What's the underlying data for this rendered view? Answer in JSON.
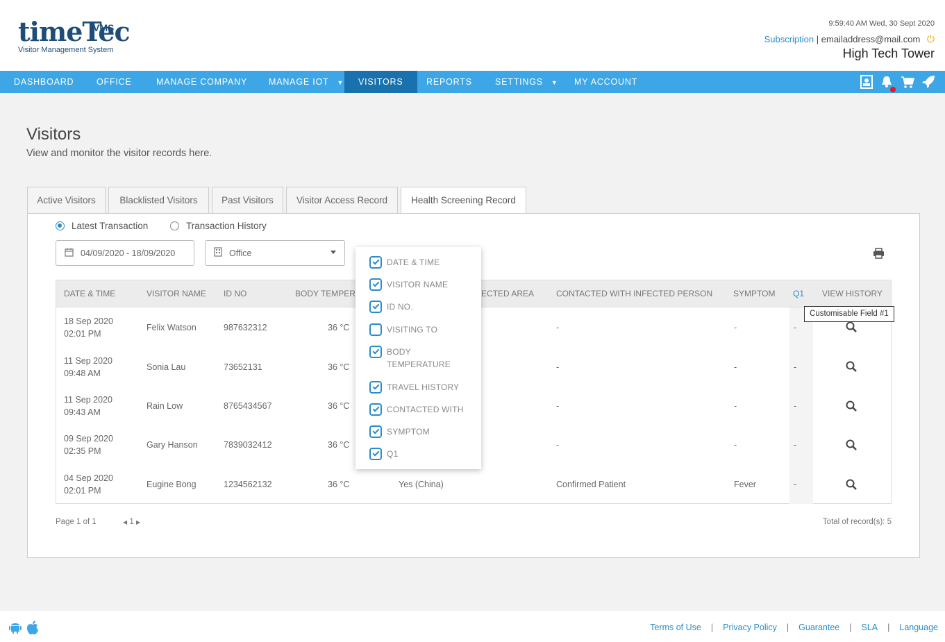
{
  "header": {
    "logo_text": "timeTec",
    "logo_badge": "VMS",
    "logo_subtitle": "Visitor Management System",
    "datetime": "9:59:40 AM  Wed, 30 Sept 2020",
    "subscription_link": "Subscription",
    "separator": "|",
    "email": "emailaddress@mail.com",
    "company": "High Tech Tower"
  },
  "nav": {
    "items": [
      "DASHBOARD",
      "OFFICE",
      "MANAGE COMPANY",
      "MANAGE IOT",
      "VISITORS",
      "REPORTS",
      "SETTINGS",
      "MY ACCOUNT"
    ],
    "active": "VISITORS",
    "icons": [
      "profile-card-icon",
      "notification-bell-icon",
      "cart-icon",
      "rocket-icon"
    ]
  },
  "page": {
    "title": "Visitors",
    "description": "View and monitor the visitor records here."
  },
  "tabs": [
    "Active Visitors",
    "Blacklisted Visitors",
    "Past Visitors",
    "Visitor Access Record",
    "Health Screening Record"
  ],
  "active_tab": "Health Screening Record",
  "view_options": {
    "latest": "Latest Transaction",
    "history": "Transaction History",
    "selected": "Latest Transaction"
  },
  "filters": {
    "date_range": "04/09/2020 - 18/09/2020",
    "location": "Office"
  },
  "table": {
    "headers": [
      "DATE & TIME",
      "VISITOR NAME",
      "ID NO",
      "BODY TEMPERA",
      "ECTED AREA",
      "CONTACTED WITH INFECTED PERSON",
      "SYMPTOM",
      "Q1",
      "VIEW HISTORY"
    ],
    "rows": [
      {
        "date": "18 Sep 2020",
        "time": "02:01 PM",
        "name": "Felix Watson",
        "id": "987632312",
        "temp": "36 °C",
        "area": "",
        "contacted": "-",
        "symptom": "-",
        "q1": "-"
      },
      {
        "date": "11 Sep 2020",
        "time": "09:48 AM",
        "name": "Sonia Lau",
        "id": "73652131",
        "temp": "36 °C",
        "area": "",
        "contacted": "-",
        "symptom": "-",
        "q1": "-"
      },
      {
        "date": "11 Sep 2020",
        "time": "09:43 AM",
        "name": "Rain Low",
        "id": "8765434567",
        "temp": "36 °C",
        "area": "",
        "contacted": "-",
        "symptom": "-",
        "q1": "-"
      },
      {
        "date": "09 Sep 2020",
        "time": "02:35 PM",
        "name": "Gary Hanson",
        "id": "7839032412",
        "temp": "36 °C",
        "area": "",
        "contacted": "-",
        "symptom": "-",
        "q1": "-"
      },
      {
        "date": "04 Sep 2020",
        "time": "02:01 PM",
        "name": "Eugine Bong",
        "id": "1234562132",
        "temp": "36 °C",
        "area": "Yes (China)",
        "contacted": "Confirmed Patient",
        "symptom": "Fever",
        "q1": "-"
      }
    ]
  },
  "tooltip": "Customisable Field #1",
  "column_chooser": [
    {
      "label": "DATE & TIME",
      "checked": true
    },
    {
      "label": "VISITOR NAME",
      "checked": true
    },
    {
      "label": "ID NO.",
      "checked": true
    },
    {
      "label": "VISITING TO",
      "checked": false
    },
    {
      "label": "BODY TEMPERATURE",
      "checked": true
    },
    {
      "label": "TRAVEL HISTORY",
      "checked": true
    },
    {
      "label": "CONTACTED WITH",
      "checked": true
    },
    {
      "label": "SYMPTOM",
      "checked": true
    },
    {
      "label": "Q1",
      "checked": true
    }
  ],
  "pagination": {
    "page_text": "Page 1 of 1",
    "current": "1",
    "total": "Total of record(s): 5"
  },
  "footer": {
    "links": [
      "Terms of Use",
      "Privacy Policy",
      "Guarantee",
      "SLA",
      "Language"
    ],
    "separator": "|"
  },
  "colors": {
    "nav_bg": "#3da6e6",
    "nav_active": "#1971ad",
    "link": "#2a8cc9",
    "brand": "#1f4d7a"
  }
}
